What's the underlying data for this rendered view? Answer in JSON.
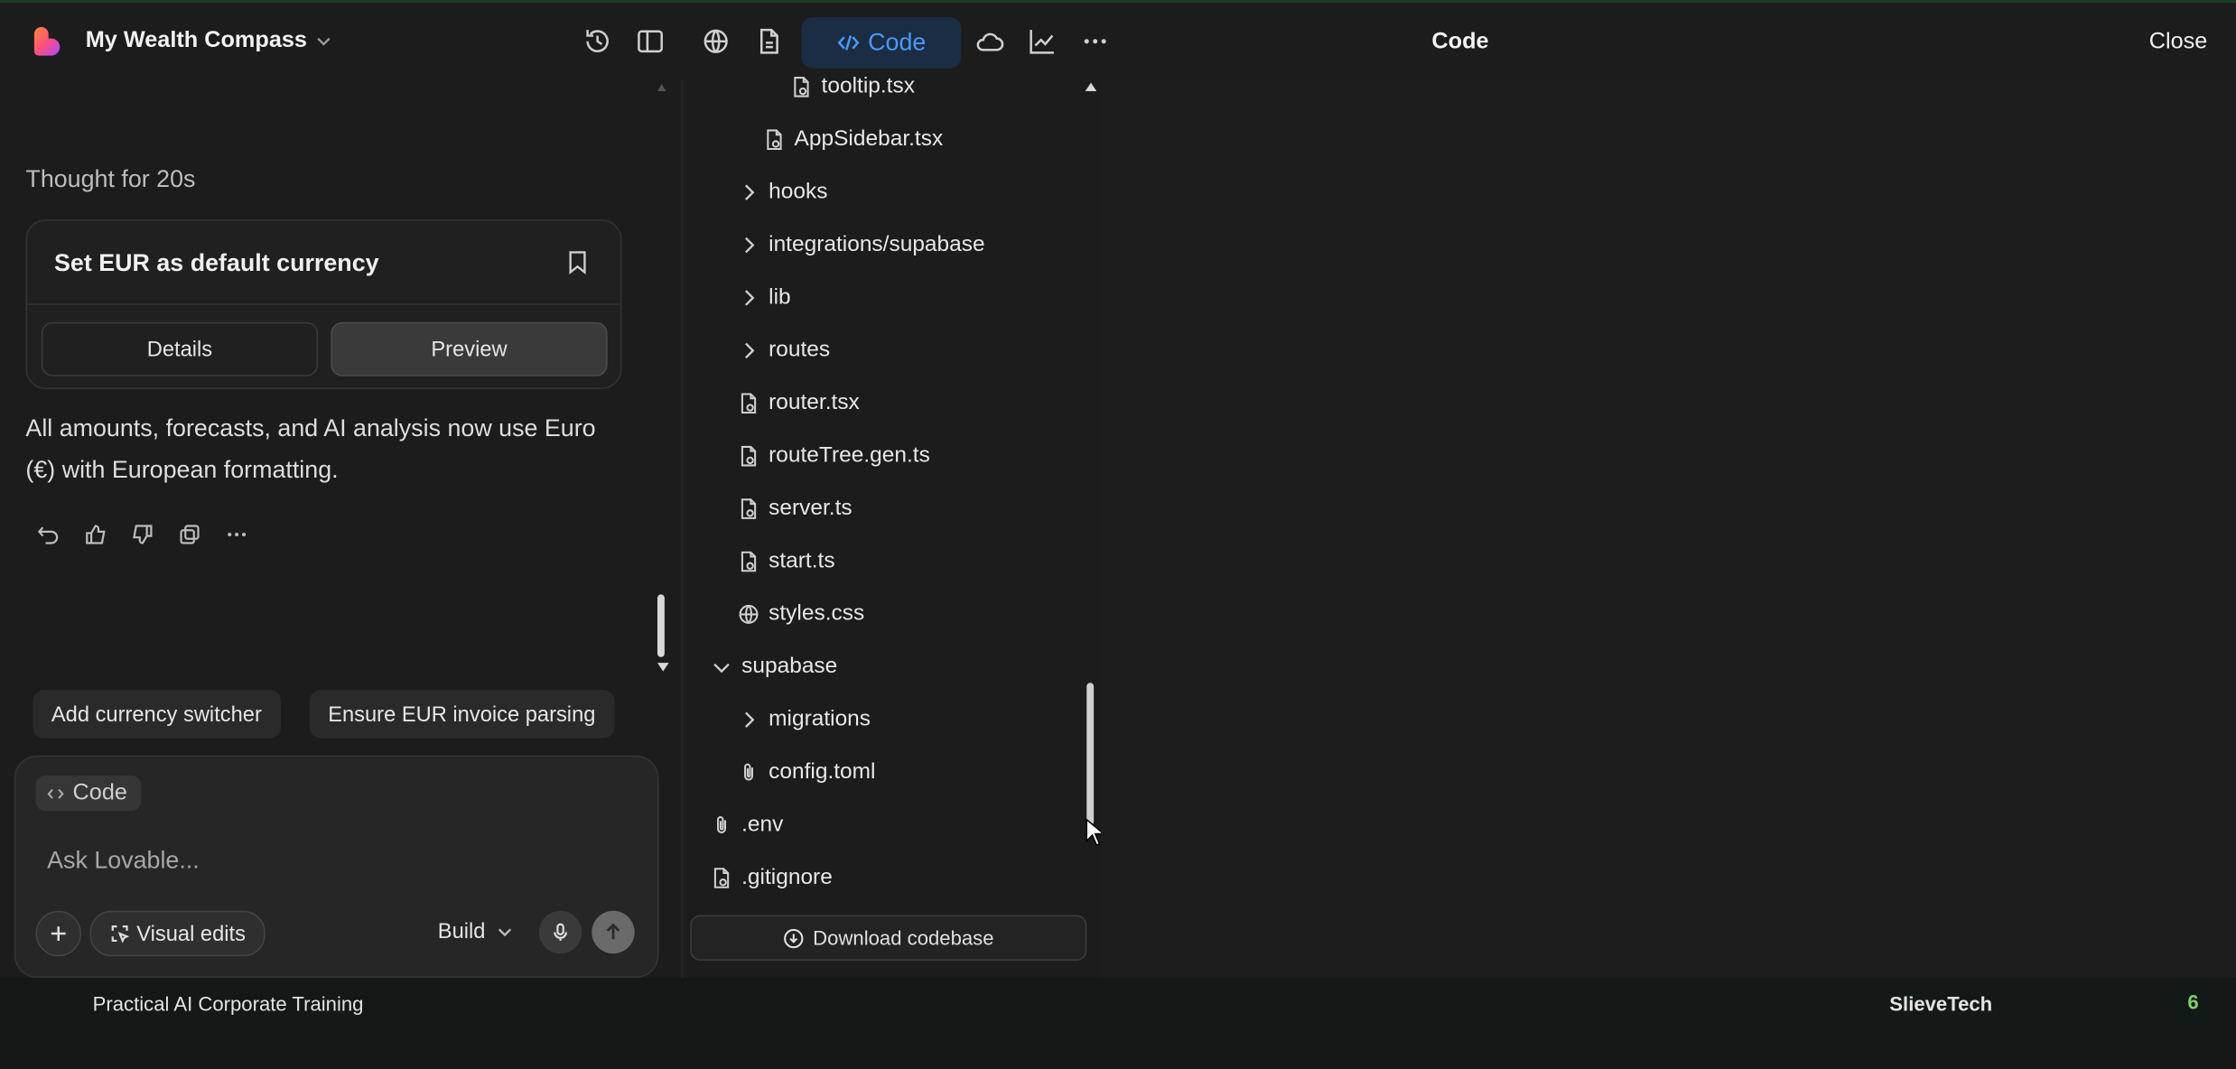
{
  "header": {
    "project_name": "My Wealth Compass",
    "active_tab_label": "Code",
    "panel_title": "Code",
    "close_label": "Close"
  },
  "chat": {
    "thought_label": "Thought for 20s",
    "card": {
      "title": "Set EUR as default currency",
      "details_label": "Details",
      "preview_label": "Preview"
    },
    "message_line1": "All amounts, forecasts, and AI analysis now use Euro",
    "message_line2": "(€) with European formatting.",
    "suggestions": [
      "Add currency switcher",
      "Ensure EUR invoice parsing"
    ],
    "input": {
      "mode_chip": "Code",
      "placeholder": "Ask Lovable...",
      "visual_edits_label": "Visual edits",
      "build_label": "Build"
    }
  },
  "file_tree": {
    "items": [
      {
        "label": "tooltip.tsx",
        "type": "file"
      },
      {
        "label": "AppSidebar.tsx",
        "type": "file"
      },
      {
        "label": "hooks",
        "type": "folder-collapsed"
      },
      {
        "label": "integrations/supabase",
        "type": "folder-collapsed"
      },
      {
        "label": "lib",
        "type": "folder-collapsed"
      },
      {
        "label": "routes",
        "type": "folder-collapsed"
      },
      {
        "label": "router.tsx",
        "type": "file"
      },
      {
        "label": "routeTree.gen.ts",
        "type": "file"
      },
      {
        "label": "server.ts",
        "type": "file"
      },
      {
        "label": "start.ts",
        "type": "file"
      },
      {
        "label": "styles.css",
        "type": "globe-file"
      },
      {
        "label": "supabase",
        "type": "folder-expanded"
      },
      {
        "label": "migrations",
        "type": "folder-collapsed"
      },
      {
        "label": "config.toml",
        "type": "attachment-file"
      },
      {
        "label": ".env",
        "type": "attachment-file"
      },
      {
        "label": ".gitignore",
        "type": "file"
      }
    ],
    "download_label": "Download codebase"
  },
  "footer": {
    "left_text": "Practical AI Corporate Training",
    "center_text": "SlieveTech",
    "right_number": "6"
  },
  "colors": {
    "accent_blue": "#4a9af5",
    "background": "#1c1c1c",
    "footer_number": "#7fd16b"
  }
}
